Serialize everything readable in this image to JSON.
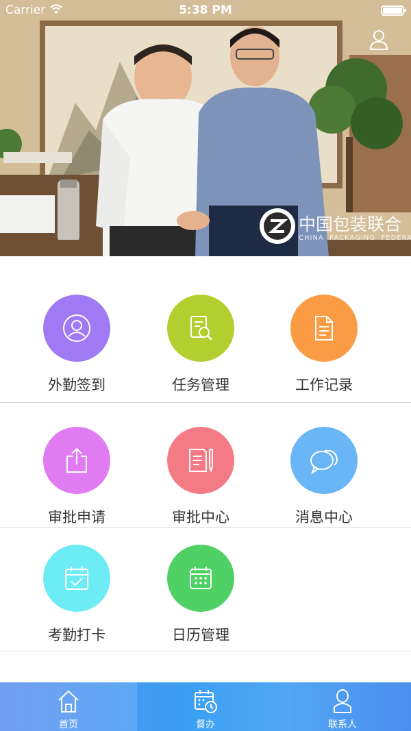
{
  "status_bar": {
    "carrier": "Carrier",
    "time": "5:38 PM"
  },
  "banner": {
    "logo_text": "中国包装联合",
    "logo_subtext": "CHINA  PACKAGING  FEDERATI"
  },
  "menu": {
    "row1": {
      "items": [
        {
          "label": "外勤签到",
          "icon": "user-circle-icon",
          "color": "#a07af5"
        },
        {
          "label": "任务管理",
          "icon": "document-search-icon",
          "color": "#b3cf2f"
        },
        {
          "label": "工作记录",
          "icon": "document-icon",
          "color": "#fb9c44"
        }
      ]
    },
    "row2": {
      "items": [
        {
          "label": "审批申请",
          "icon": "share-upload-icon",
          "color": "#e07bf2"
        },
        {
          "label": "审批中心",
          "icon": "document-edit-icon",
          "color": "#f47b86"
        },
        {
          "label": "消息中心",
          "icon": "chat-bubbles-icon",
          "color": "#6ab5f5"
        }
      ]
    },
    "row3": {
      "items": [
        {
          "label": "考勤打卡",
          "icon": "calendar-check-icon",
          "color": "#6eecf5"
        },
        {
          "label": "日历管理",
          "icon": "calendar-grid-icon",
          "color": "#4fd166"
        }
      ]
    }
  },
  "tabbar": {
    "items": [
      {
        "label": "首页",
        "icon": "home-icon",
        "active": true
      },
      {
        "label": "督办",
        "icon": "calendar-clock-icon",
        "active": false
      },
      {
        "label": "联系人",
        "icon": "person-icon",
        "active": false
      }
    ]
  }
}
